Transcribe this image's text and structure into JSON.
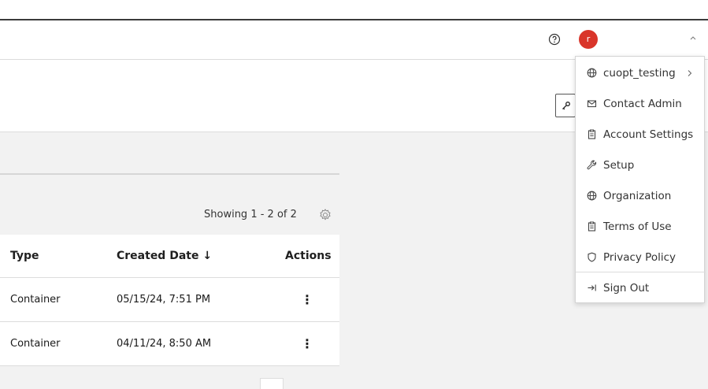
{
  "header": {
    "avatar_initial": "r",
    "avatar_color": "#d9352a"
  },
  "table": {
    "showing_text": "Showing 1 - 2 of 2",
    "columns": {
      "type": "Type",
      "created": "Created Date ↓",
      "actions": "Actions"
    },
    "rows": [
      {
        "type": "Container",
        "created": "05/15/24, 7:51 PM",
        "menu": "⋮"
      },
      {
        "type": "Container",
        "created": "04/11/24, 8:50 AM",
        "menu": "⋮"
      }
    ]
  },
  "user_menu": {
    "items": [
      {
        "label": "cuopt_testing",
        "icon": "globe-icon",
        "has_submenu": true
      },
      {
        "label": "Contact Admin",
        "icon": "mail-icon"
      },
      {
        "label": "Account Settings",
        "icon": "clipboard-icon"
      },
      {
        "label": "Setup",
        "icon": "wrench-icon"
      },
      {
        "label": "Organization",
        "icon": "globe-icon"
      },
      {
        "label": "Terms of Use",
        "icon": "clipboard-icon"
      },
      {
        "label": "Privacy Policy",
        "icon": "shield-icon"
      },
      {
        "label": "Sign Out",
        "icon": "sign-out-icon"
      }
    ]
  }
}
